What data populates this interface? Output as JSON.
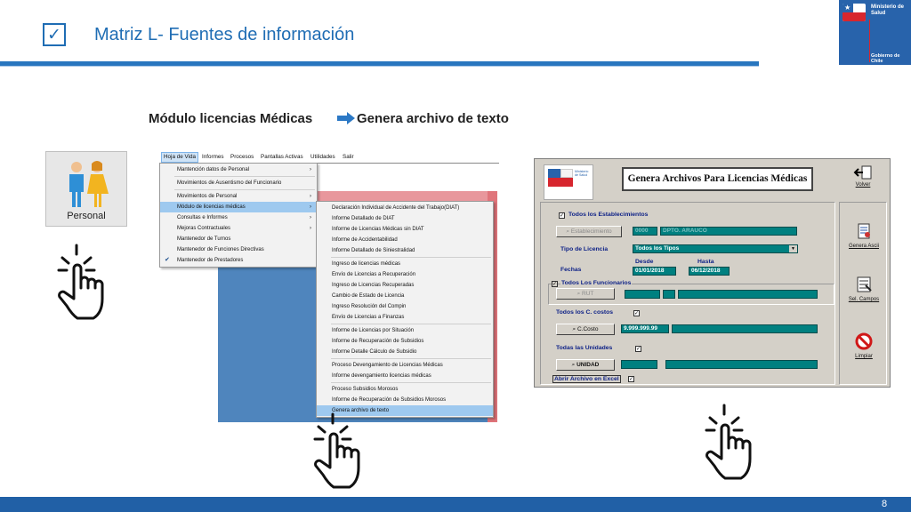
{
  "slide": {
    "title": "Matriz L- Fuentes de información",
    "check_glyph": "✓",
    "subtitle_left": "Módulo licencias Médicas",
    "subtitle_right": "Genera archivo de texto",
    "page_number": "8",
    "colors": {
      "accent": "#1f6db4",
      "rule": "#2876bf",
      "footer": "#2160a6",
      "brand_red": "#d7262e"
    }
  },
  "logo": {
    "ministry": "Ministerio de Salud",
    "government": "Gobierno de Chile"
  },
  "personal_button": {
    "label": "Personal",
    "icon": "people-icon"
  },
  "menubar": {
    "items": [
      "Hoja de Vida",
      "Informes",
      "Procesos",
      "Pantallas Activas",
      "Utilidades",
      "Salir"
    ]
  },
  "menu_hoja_vida": {
    "items": [
      {
        "label": "Mantención datos de Personal",
        "submenu": true
      },
      {
        "label": "Movimientos de Ausentismo del Funcionario",
        "submenu": false
      },
      {
        "label": "Movimientos de Personal",
        "submenu": true
      },
      {
        "label": "Módulo de licencias médicas",
        "submenu": true,
        "highlighted": true
      },
      {
        "label": "Consultas e Informes",
        "submenu": true
      },
      {
        "label": "Mejoras Contractuales",
        "submenu": true
      },
      {
        "label": "Mantenedor de Turnos",
        "submenu": false
      },
      {
        "label": "Mantenedor de Funciones Directivas",
        "submenu": false
      },
      {
        "label": "Mantenedor de Prestadores",
        "submenu": false,
        "checked": true
      }
    ]
  },
  "menu_licencias": {
    "items": [
      "Declaración Individual de Accidente del Trabajo(DIAT)",
      "Informe Detallado de DIAT",
      "Informe de Licencias Médicas sin DIAT",
      "Informe de Accidentabilidad",
      "Informe Detallado de Siniestralidad",
      "Ingreso de licencias médicas",
      "Envío de Licencias a Recuperación",
      "Ingreso de Licencias Recuperadas",
      "Cambio de Estado de Licencia",
      "Ingreso Resolución del Compin",
      "Envío de Licencias a Finanzas",
      "Informe de Licencias por Situación",
      "Informe de Recuperación de Subsidios",
      "Informe Detalle Cálculo de Subsidio",
      "Proceso Devengamiento de Licencias Médicas",
      "Informe devengamiento licencias médicas",
      "Proceso Subsidios Morosos",
      "Informe de Recuperación de Subsidios Morosos",
      "Genera archivo de texto"
    ]
  },
  "dialog": {
    "title": "Genera Archivos Para Licencias Médicas",
    "logo_text": "Ministerio de Salud",
    "todos_establecimientos": "Todos los Establecimientos",
    "establecimiento_button": "Establecimiento",
    "establecimiento_code": "0000",
    "establecimiento_name": "DPTO. ARAUCO",
    "tipo_licencia_label": "Tipo de Licencia",
    "tipo_licencia_value": "Todos los Tipos",
    "fechas_label": "Fechas",
    "desde_label": "Desde",
    "hasta_label": "Hasta",
    "desde_value": "01/01/2018",
    "hasta_value": "06/12/2018",
    "todos_funcionarios": "Todos Los Funcionarios",
    "rut_button": "RUT",
    "todos_ccostos": "Todos los C. costos",
    "ccosto_button": "C.Costo",
    "ccosto_value": "9.999.999.99",
    "todas_unidades": "Todas las Unidades",
    "unidad_button": "UNIDAD",
    "abrir_excel": "Abrir Archivo en Excel",
    "side_buttons": {
      "volver": "Volver",
      "genera": "Genera Ascii",
      "sel_campos": "Sel. Campos",
      "limpiar": "Limpiar"
    }
  },
  "cursors": [
    "tap-hand-icon",
    "tap-hand-icon",
    "tap-hand-icon"
  ]
}
